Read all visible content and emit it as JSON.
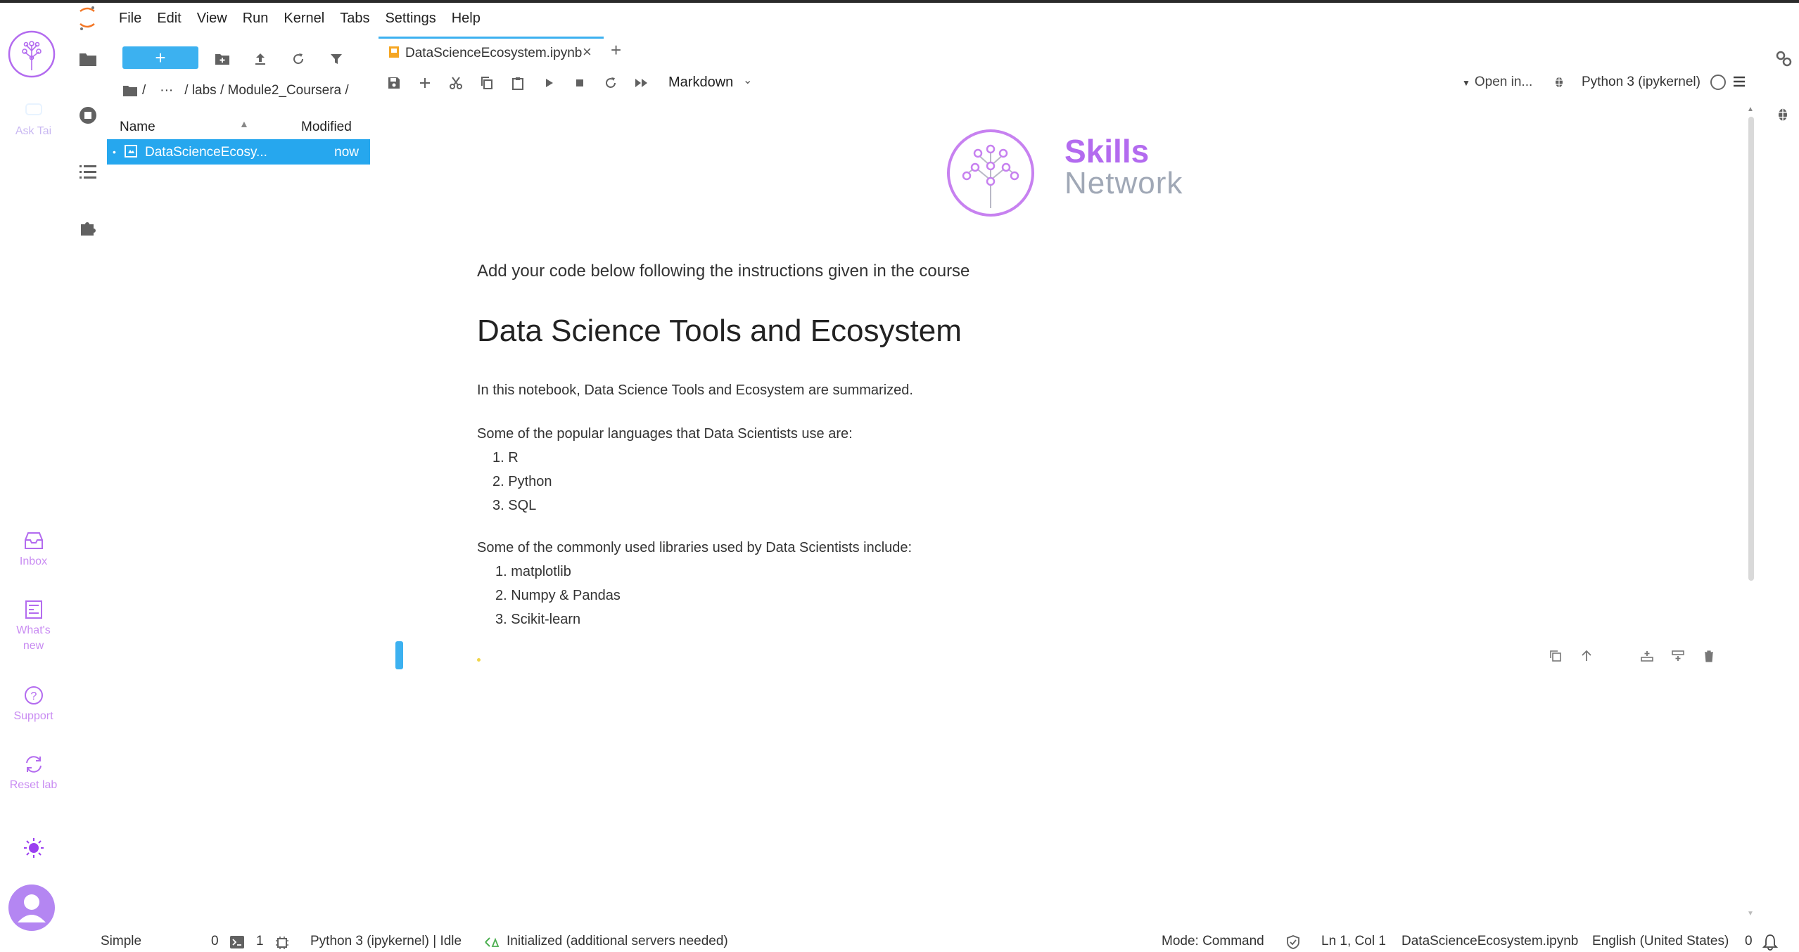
{
  "menubar": {
    "items": [
      "File",
      "Edit",
      "View",
      "Run",
      "Kernel",
      "Tabs",
      "Settings",
      "Help"
    ]
  },
  "left_strip": {
    "ask_label": "Ask Tai",
    "inbox_label": "Inbox",
    "whats_new_label": "What's new",
    "support_label": "Support",
    "reset_label": "Reset lab"
  },
  "file_browser": {
    "new_button": "+",
    "breadcrumb": [
      "/",
      "···",
      "/ labs / Module2_Coursera /"
    ],
    "header_name": "Name",
    "header_modified": "Modified",
    "files": [
      {
        "name": "DataScienceEcosy...",
        "modified": "now"
      }
    ]
  },
  "tabs": [
    {
      "label": "DataScienceEcosystem.ipynb",
      "close": "×"
    }
  ],
  "tab_add": "+",
  "toolbar": {
    "cell_type": "Markdown",
    "open_in": "Open in...",
    "kernel": "Python 3 (ipykernel)"
  },
  "notebook": {
    "logo_title1": "Skills",
    "logo_title2": "Network",
    "intro": "Add your code below following the instructions given in the course",
    "heading": "Data Science Tools and Ecosystem",
    "summary": "In this notebook, Data Science Tools and Ecosystem are summarized.",
    "languages_intro": "Some of the popular languages that Data Scientists use are:",
    "languages": [
      "1. R",
      "2. Python",
      "3. SQL"
    ],
    "libraries_intro": "Some of the commonly used libraries used by Data Scientists include:",
    "libraries": [
      "1. matplotlib",
      "2. Numpy & Pandas",
      "3. Scikit-learn"
    ]
  },
  "status_bar": {
    "mode_simple": "Simple",
    "terminals_count": "0",
    "kernels_count": "1",
    "kernel_status": "Python 3 (ipykernel) | Idle",
    "lsp_status": "Initialized (additional servers needed)",
    "mode": "Mode: Command",
    "cursor": "Ln 1, Col 1",
    "filename": "DataScienceEcosystem.ipynb",
    "language": "English (United States)",
    "notifications": "0"
  },
  "colors": {
    "accent_blue": "#3cb1f0",
    "brand_purple": "#b36bef",
    "brand_gray": "#a0a8b6"
  }
}
